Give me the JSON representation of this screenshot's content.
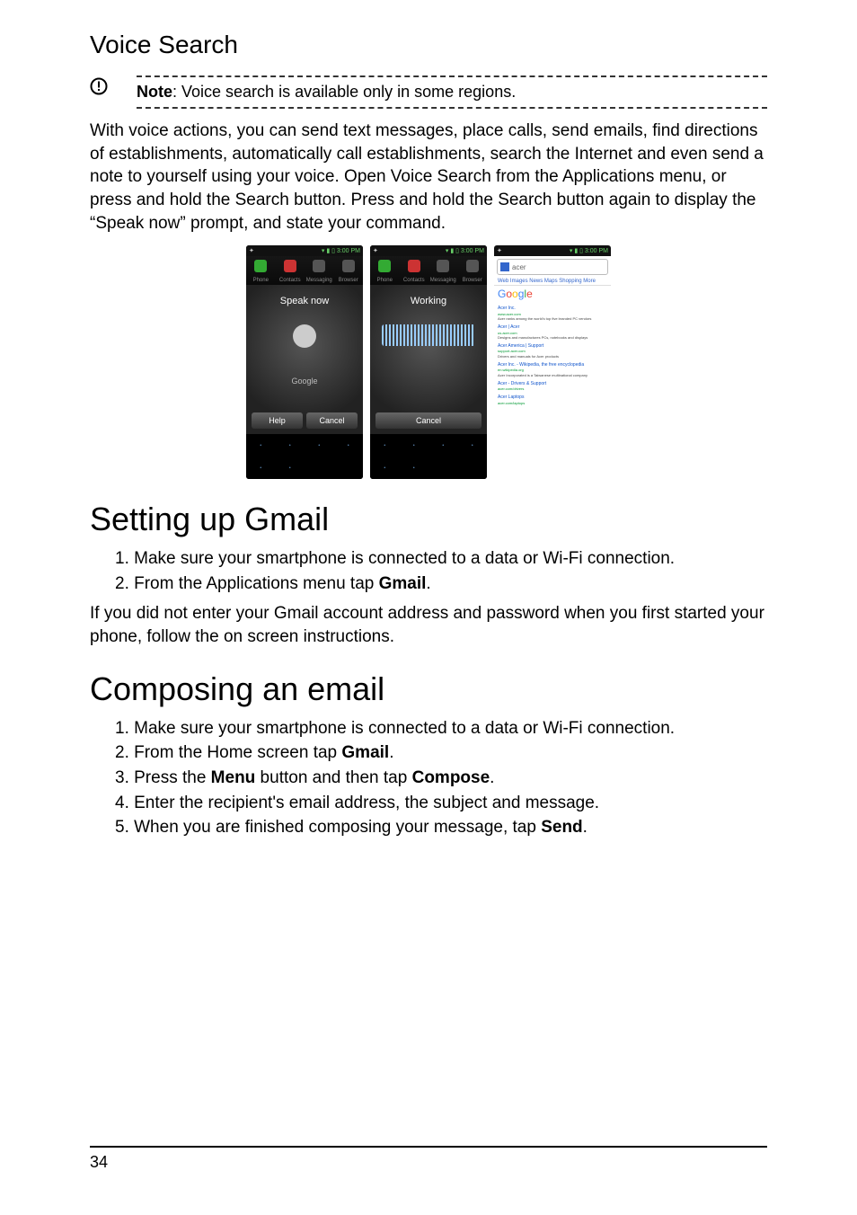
{
  "page_number": "34",
  "h_voice_search": "Voice Search",
  "note_label": "Note",
  "note_text": ": Voice search is available only in some regions.",
  "voice_body": "With voice actions, you can send text messages, place calls, send emails, find directions of establishments, automatically call establishments, search the Internet and even send a note to yourself using your voice. Open Voice Search from the Applications menu, or press and hold the Search button. Press and hold the Search button again to display the “Speak now” prompt, and state your command.",
  "shot_time": "3:00 PM",
  "shot1_title": "Speak now",
  "shot1_brand": "Google",
  "shot1_btn_help": "Help",
  "shot1_btn_cancel": "Cancel",
  "shot2_title": "Working",
  "shot2_btn_cancel": "Cancel",
  "shot3_query": "acer",
  "dock": {
    "phone": "Phone",
    "contacts": "Contacts",
    "messaging": "Messaging",
    "browser": "Browser"
  },
  "h_gmail": "Setting up Gmail",
  "gmail_li1_pre": "1. Make sure your smartphone is connected to a data or Wi-Fi connection.",
  "gmail_li2_pre": "2. From the Applications menu tap ",
  "gmail_li2_b": "Gmail",
  "gmail_li2_post": ".",
  "gmail_body": "If you did not enter your Gmail account address and password when you first started your phone, follow the on screen instructions.",
  "h_compose": "Composing an email",
  "comp_li1": "1. Make sure your smartphone is connected to a data or Wi-Fi connection.",
  "comp_li2_pre": "2. From the Home screen tap ",
  "comp_li2_b": "Gmail",
  "comp_li2_post": ".",
  "comp_li3_pre": "3. Press the ",
  "comp_li3_b1": "Menu",
  "comp_li3_mid": " button and then tap ",
  "comp_li3_b2": "Compose",
  "comp_li3_post": ".",
  "comp_li4": "4. Enter the recipient's email address, the subject and message.",
  "comp_li5_pre": "5. When you are finished composing your message, tap ",
  "comp_li5_b": "Send",
  "comp_li5_post": "."
}
